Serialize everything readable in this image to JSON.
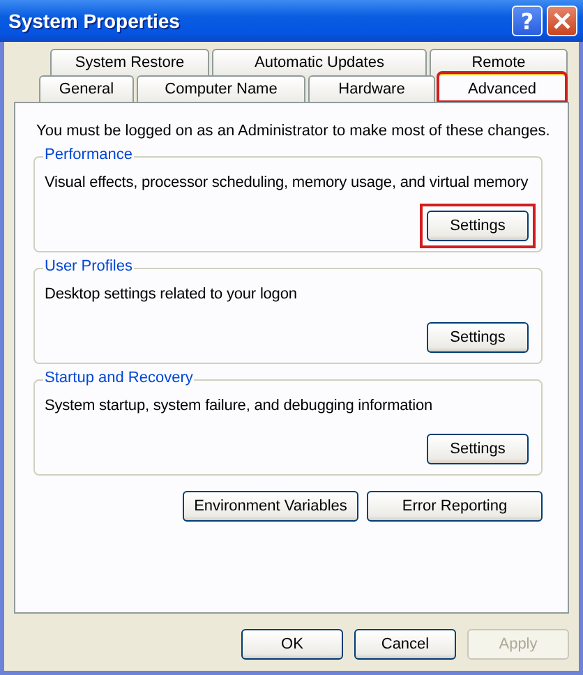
{
  "window": {
    "title": "System Properties",
    "help_button": "?"
  },
  "tab_rows": [
    [
      {
        "label": "System Restore",
        "selected": false,
        "highlighted": false
      },
      {
        "label": "Automatic Updates",
        "selected": false,
        "highlighted": false
      },
      {
        "label": "Remote",
        "selected": false,
        "highlighted": false
      }
    ],
    [
      {
        "label": "General",
        "selected": false,
        "highlighted": false
      },
      {
        "label": "Computer Name",
        "selected": false,
        "highlighted": false
      },
      {
        "label": "Hardware",
        "selected": false,
        "highlighted": false
      },
      {
        "label": "Advanced",
        "selected": true,
        "highlighted": true
      }
    ]
  ],
  "intro": "You must be logged on as an Administrator to make most of these changes.",
  "groups": [
    {
      "title": "Performance",
      "description": "Visual effects, processor scheduling, memory usage, and virtual memory",
      "button": "Settings",
      "highlighted": true
    },
    {
      "title": "User Profiles",
      "description": "Desktop settings related to your logon",
      "button": "Settings",
      "highlighted": false
    },
    {
      "title": "Startup and Recovery",
      "description": "System startup, system failure, and debugging information",
      "button": "Settings",
      "highlighted": false
    }
  ],
  "panel_buttons": [
    "Environment Variables",
    "Error Reporting"
  ],
  "dialog_buttons": [
    {
      "label": "OK",
      "disabled": false
    },
    {
      "label": "Cancel",
      "disabled": false
    },
    {
      "label": "Apply",
      "disabled": true
    }
  ]
}
